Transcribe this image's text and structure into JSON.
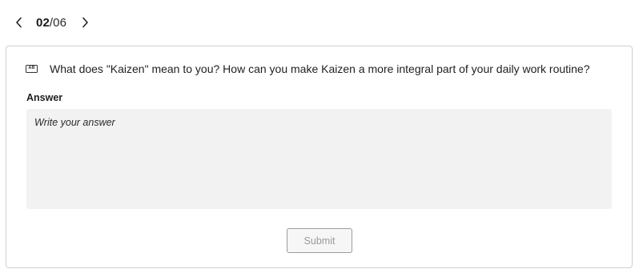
{
  "pager": {
    "current": "02",
    "separator": "/",
    "total": "06",
    "prev_icon": "chevron-left-icon",
    "next_icon": "chevron-right-icon"
  },
  "question": {
    "icon": "qa-badge-icon",
    "icon_text": "AB",
    "text": "What does \"Kaizen\" mean to you? How can you make Kaizen a more integral part of your daily work routine?"
  },
  "answer": {
    "label": "Answer",
    "placeholder": "Write your answer",
    "value": ""
  },
  "submit": {
    "label": "Submit",
    "disabled": true
  },
  "colors": {
    "card_border": "#cfcfcf",
    "answer_bg": "#f2f2f2",
    "submit_text": "#9a9a9a"
  }
}
